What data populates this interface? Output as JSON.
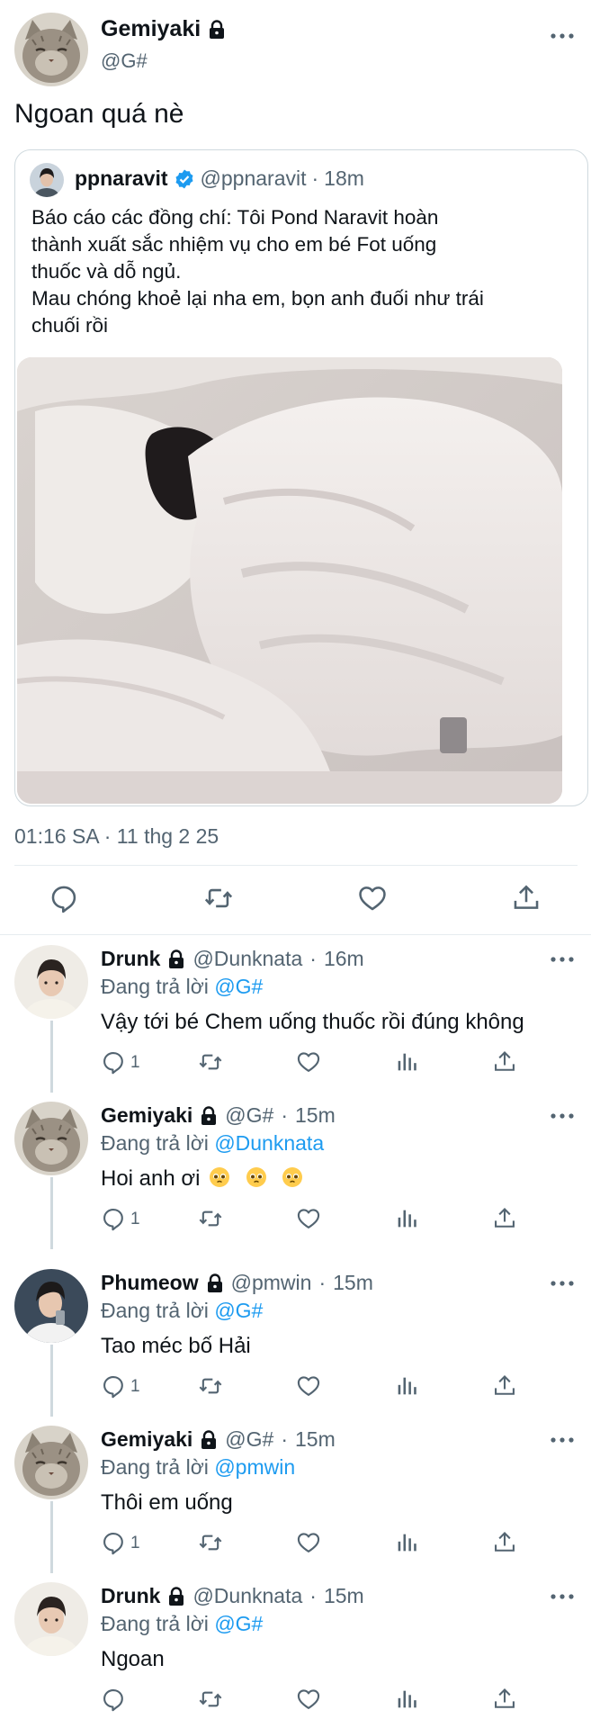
{
  "main_tweet": {
    "author_name": "Gemiyaki",
    "handle": "@G#",
    "text": "Ngoan quá nè",
    "timestamp": "01:16 SA · 11 thg 2 25"
  },
  "quoted_tweet": {
    "author_name": "ppnaravit",
    "handle": "@ppnaravit",
    "separator": "·",
    "time": "18m",
    "lines": [
      "Báo cáo các đồng chí: Tôi Pond Naravit hoàn",
      "thành xuất sắc nhiệm vụ cho em bé Fot uống",
      "thuốc và dỗ ngủ.",
      "Mau chóng khoẻ lại nha em, bọn anh đuối như trái",
      "chuối rồi"
    ]
  },
  "replies": [
    {
      "author_name": "Drunk",
      "handle": "@Dunknata",
      "separator": "·",
      "time": "16m",
      "replying_label": "Đang trả lời",
      "replying_to": "@G#",
      "text": "Vậy tới bé Chem uống thuốc rồi đúng không",
      "reply_count": "1"
    },
    {
      "author_name": "Gemiyaki",
      "handle": "@G#",
      "separator": "·",
      "time": "15m",
      "replying_label": "Đang trả lời",
      "replying_to": "@Dunknata",
      "text": "Hoi anh ơi",
      "reply_count": "1"
    },
    {
      "author_name": "Phumeow",
      "handle": "@pmwin",
      "separator": "·",
      "time": "15m",
      "replying_label": "Đang trả lời",
      "replying_to": "@G#",
      "text": "Tao méc bố Hải",
      "reply_count": "1"
    },
    {
      "author_name": "Gemiyaki",
      "handle": "@G#",
      "separator": "·",
      "time": "15m",
      "replying_label": "Đang trả lời",
      "replying_to": "@pmwin",
      "text": "Thôi em uống",
      "reply_count": "1"
    },
    {
      "author_name": "Drunk",
      "handle": "@Dunknata",
      "separator": "·",
      "time": "15m",
      "replying_label": "Đang trả lời",
      "replying_to": "@G#",
      "text": "Ngoan",
      "reply_count": ""
    }
  ],
  "colors": {
    "link": "#1d9bf0",
    "secondary_text": "#536471",
    "primary_text": "#0f1419",
    "verified_badge": "#1d9bf0"
  },
  "icons": [
    "lock-icon",
    "verified-icon",
    "more-icon",
    "reply-icon",
    "retweet-icon",
    "like-icon",
    "views-icon",
    "share-icon",
    "pleading-face-emoji"
  ]
}
